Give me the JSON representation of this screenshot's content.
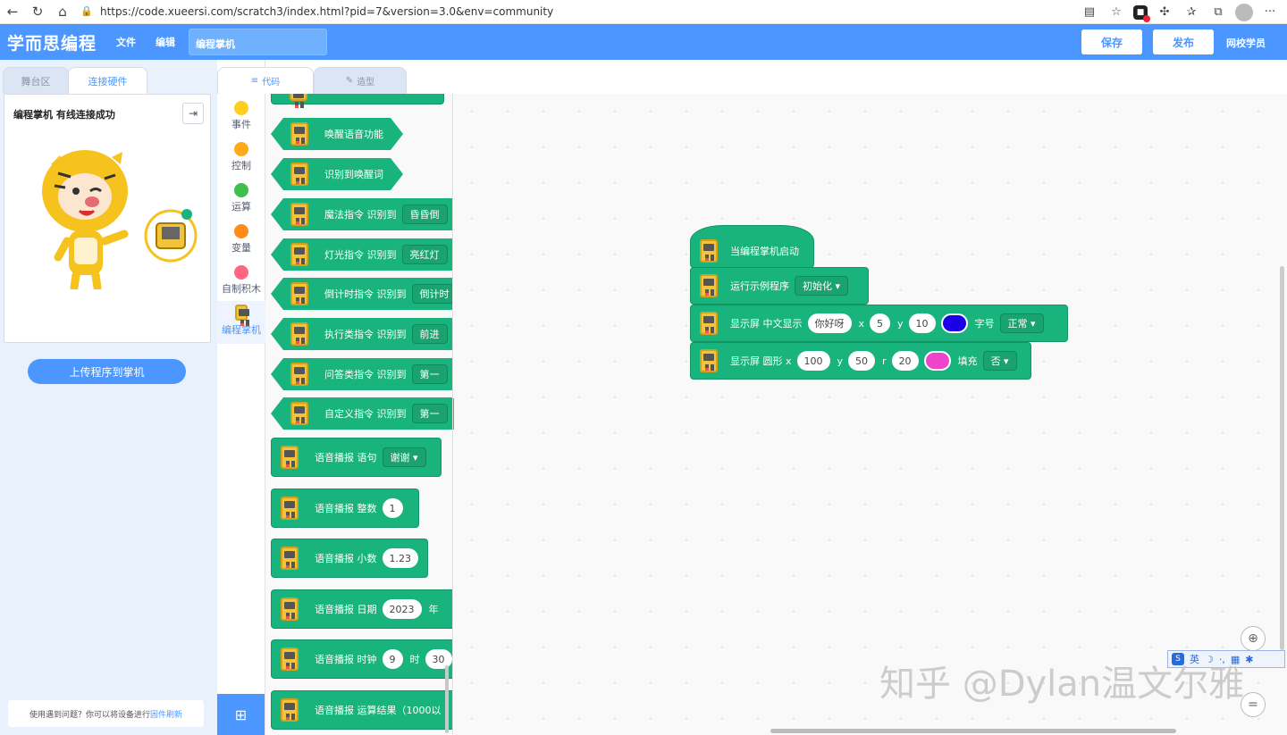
{
  "browser": {
    "url": "https://code.xueersi.com/scratch3/index.html?pid=7&version=3.0&env=community"
  },
  "app_bar": {
    "logo": "学而思编程",
    "menu_file": "文件",
    "menu_edit": "编辑",
    "project_title": "编程掌机",
    "save": "保存",
    "publish": "发布",
    "user": "网校学员"
  },
  "left_panel": {
    "tab_stage": "舞台区",
    "tab_hardware": "连接硬件",
    "status": "编程掌机 有线连接成功",
    "upload_button": "上传程序到掌机",
    "help_text": "使用遇到问题？你可以将设备进行",
    "help_link": "固件刷新"
  },
  "tabs": {
    "code": "代码",
    "costume": "造型"
  },
  "categories": [
    {
      "label": "事件",
      "color": "#ffcf1f"
    },
    {
      "label": "控制",
      "color": "#ffab19"
    },
    {
      "label": "运算",
      "color": "#40bf4a"
    },
    {
      "label": "变量",
      "color": "#ff8c1a"
    },
    {
      "label": "自制积木",
      "color": "#ff6680"
    },
    {
      "label": "编程掌机",
      "color": "#f3c43b"
    }
  ],
  "flyout": {
    "b1": "唤醒语音功能",
    "b2": "识别到唤醒词",
    "b3_text": "魔法指令 识别到",
    "b3_val": "昏昏倒",
    "b4_text": "灯光指令 识别到",
    "b4_val": "亮红灯",
    "b5_text": "倒计时指令 识别到",
    "b5_val": "倒计时",
    "b6_text": "执行类指令 识别到",
    "b6_val": "前进",
    "b7_text": "问答类指令 识别到",
    "b7_val": "第一",
    "b8_text": "自定义指令 识别到",
    "b8_val": "第一",
    "b9_text": "语音播报 语句",
    "b9_val": "谢谢",
    "b10_text": "语音播报 整数",
    "b10_val": "1",
    "b11_text": "语音播报 小数",
    "b11_val": "1.23",
    "b12_text": "语音播报 日期",
    "b12_val": "2023",
    "b12_unit": "年",
    "b13_text": "语音播报 时钟",
    "b13_val": "9",
    "b13_unit": "时",
    "b13_val2": "30",
    "b14_text": "语音播报 运算结果（1000以"
  },
  "script": {
    "hat": "当编程掌机启动",
    "s1_text": "运行示例程序",
    "s1_val": "初始化",
    "s2_text": "显示屏 中文显示",
    "s2_str": "你好呀",
    "s2_x_label": "x",
    "s2_x": "5",
    "s2_y_label": "y",
    "s2_y": "10",
    "s2_color": "#1a00e6",
    "s2_size_label": "字号",
    "s2_size": "正常",
    "s3_text": "显示屏 圆形 x",
    "s3_x": "100",
    "s3_y_label": "y",
    "s3_y": "50",
    "s3_r_label": "r",
    "s3_r": "20",
    "s3_color": "#ee44cc",
    "s3_fill_label": "填充",
    "s3_fill": "否"
  },
  "ime": {
    "lang": "英"
  },
  "watermark": "知乎 @Dylan温文尔雅"
}
